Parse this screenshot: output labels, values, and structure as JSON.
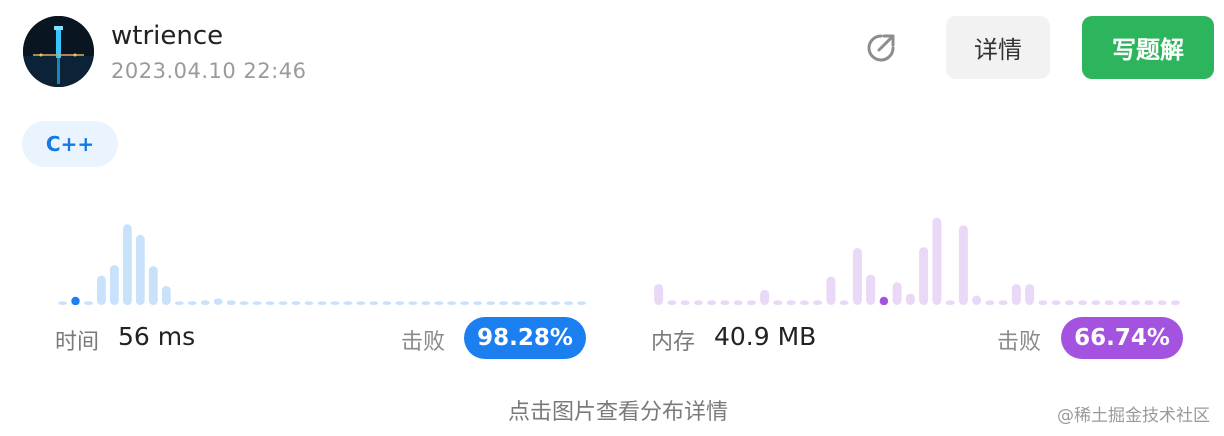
{
  "header": {
    "username": "wtrience",
    "timestamp": "2023.04.10 22:46",
    "share_icon": "external-link-icon",
    "detail_label": "详情",
    "solution_label": "写题解"
  },
  "language": "C++",
  "runtime": {
    "label": "时间",
    "value": "56 ms",
    "beat_label": "击败",
    "beat_percent": "98.28%",
    "accent": "#1b7ff0",
    "bar_color": "#c9e2fb",
    "chart_data": {
      "type": "bar",
      "values": [
        4,
        4,
        4,
        31,
        42,
        85,
        74,
        41,
        20,
        4,
        4,
        5,
        7,
        5,
        4,
        4,
        4,
        4,
        4,
        4,
        4,
        4,
        4,
        4,
        4,
        4,
        4,
        4,
        4,
        4,
        4,
        4,
        4,
        4,
        4,
        4,
        4,
        4,
        4,
        4,
        4
      ],
      "highlight_index": 1
    }
  },
  "memory": {
    "label": "内存",
    "value": "40.9 MB",
    "beat_label": "击败",
    "beat_percent": "66.74%",
    "accent": "#a453e0",
    "bar_color": "#ead8f7",
    "chart_data": {
      "type": "bar",
      "values": [
        22,
        5,
        5,
        5,
        5,
        5,
        5,
        5,
        16,
        5,
        5,
        5,
        5,
        30,
        5,
        60,
        32,
        5,
        24,
        12,
        61,
        92,
        5,
        84,
        10,
        5,
        5,
        22,
        22,
        5,
        5,
        5,
        5,
        5,
        5,
        5,
        5,
        5,
        5,
        5
      ],
      "highlight_index": 17
    }
  },
  "hint": "点击图片查看分布详情",
  "watermark": "@稀土掘金技术社区"
}
